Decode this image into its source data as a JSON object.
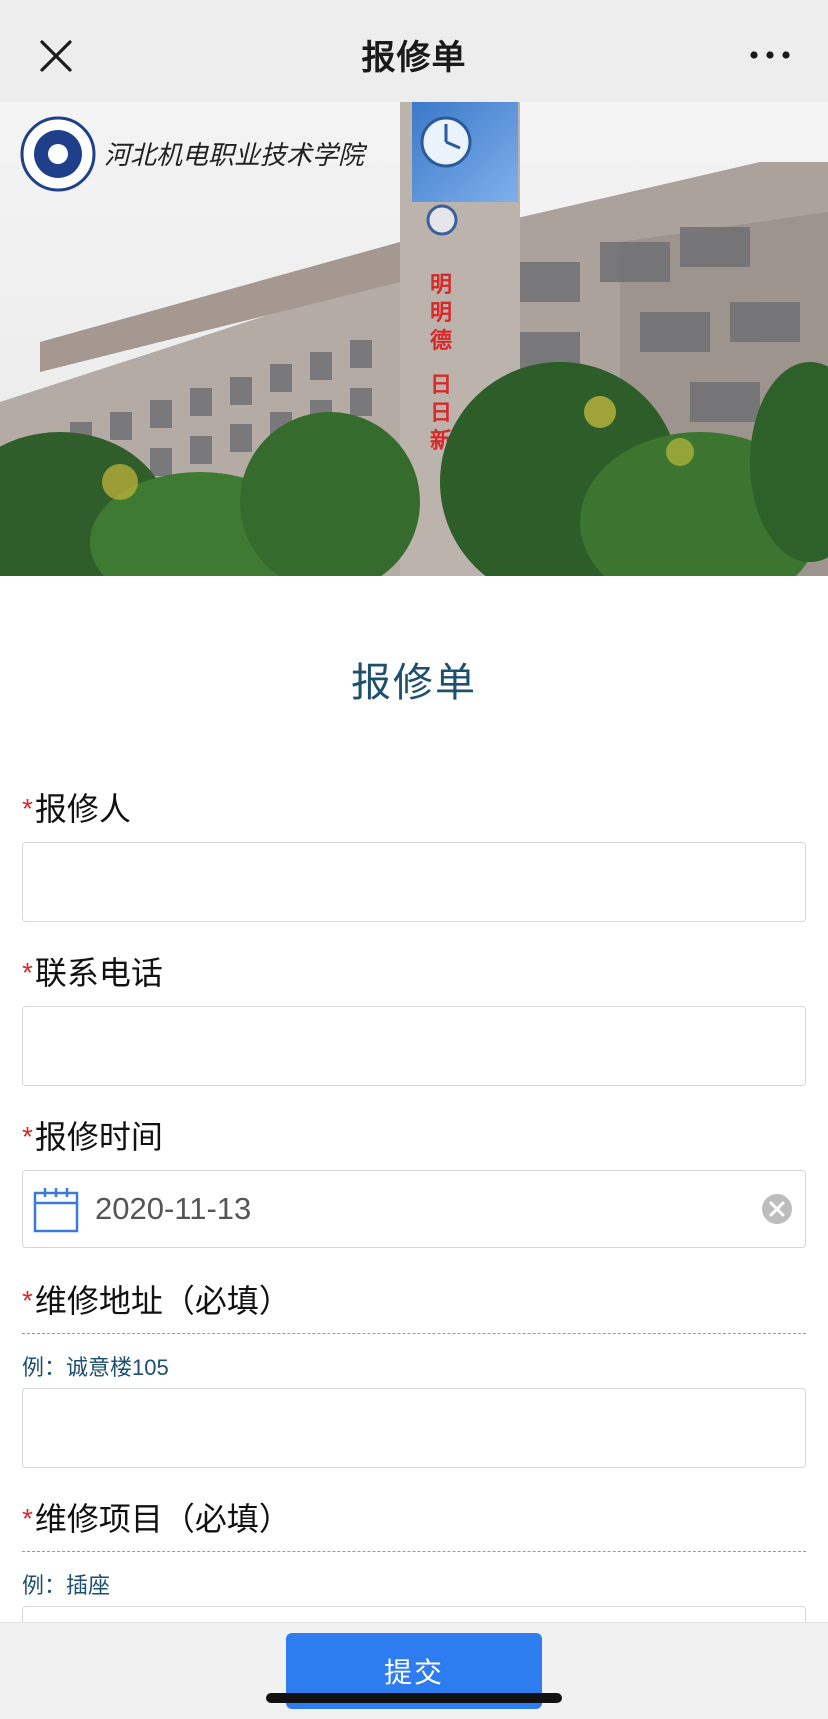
{
  "nav": {
    "title": "报修单",
    "close_icon": "close-icon",
    "more_icon": "more-icon"
  },
  "banner": {
    "school_name": "河北机电职业技术学院",
    "building_sign": "",
    "tower_text": [
      "明",
      "明",
      "德",
      "日",
      "日",
      "新"
    ]
  },
  "form": {
    "title": "报修单",
    "required_mark": "*",
    "fields": [
      {
        "label": "报修人",
        "value": ""
      },
      {
        "label": "联系电话",
        "value": ""
      },
      {
        "label": "报修时间",
        "value": "2020-11-13"
      },
      {
        "label": "维修地址（必填）",
        "hint": "例：诚意楼105",
        "value": ""
      },
      {
        "label": "维修项目（必填）",
        "hint": "例：插座",
        "value": ""
      }
    ]
  },
  "footer": {
    "submit_label": "提交"
  },
  "colors": {
    "accent": "#2d7cf0",
    "title": "#1d4f6f",
    "required": "#e0282b"
  }
}
